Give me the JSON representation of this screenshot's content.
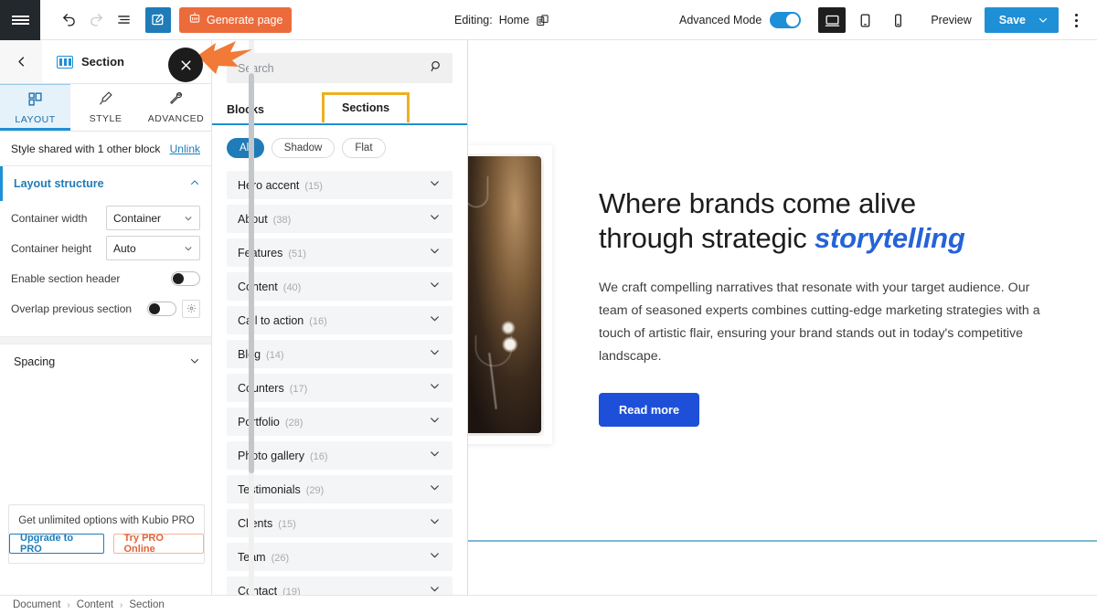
{
  "topbar": {
    "menu_icon": "hamburger-icon",
    "undo_icon": "undo-icon",
    "redo_icon": "redo-icon",
    "list_view_icon": "list-view-icon",
    "edit_icon": "edit-page-icon",
    "generate_label": "Generate page",
    "generate_icon": "ai-icon",
    "editing_label": "Editing:",
    "editing_page": "Home",
    "page_switch_icon": "page-switch-icon",
    "advanced_mode_label": "Advanced Mode",
    "advanced_mode_on": true,
    "desktop_icon": "desktop-icon",
    "tablet_icon": "tablet-icon",
    "mobile_icon": "mobile-icon",
    "preview_label": "Preview",
    "save_label": "Save",
    "save_caret_icon": "chevron-down-icon",
    "more_icon": "kebab-menu-icon"
  },
  "inspector": {
    "back_icon": "chevron-left-icon",
    "block_icon": "section-block-icon",
    "title": "Section",
    "close_icon": "close-icon",
    "tabs": [
      {
        "label": "LAYOUT",
        "icon": "layout-icon",
        "active": true
      },
      {
        "label": "STYLE",
        "icon": "brush-icon",
        "active": false
      },
      {
        "label": "ADVANCED",
        "icon": "wrench-icon",
        "active": false
      }
    ],
    "shared_text": "Style shared with 1 other block",
    "unlink_label": "Unlink",
    "layout_structure": {
      "title": "Layout structure",
      "expanded": true,
      "collapse_icon": "chevron-up-icon",
      "fields": [
        {
          "label": "Container width",
          "type": "select",
          "value": "Container"
        },
        {
          "label": "Container height",
          "type": "select",
          "value": "Auto"
        },
        {
          "label": "Enable section header",
          "type": "toggle",
          "value": false
        },
        {
          "label": "Overlap previous section",
          "type": "toggle",
          "value": false,
          "has_gear": true
        }
      ]
    },
    "spacing": {
      "title": "Spacing",
      "expanded": false,
      "expand_icon": "chevron-down-icon"
    },
    "pro": {
      "text": "Get unlimited options with Kubio PRO",
      "upgrade_label": "Upgrade to PRO",
      "try_label": "Try PRO Online"
    }
  },
  "breadcrumb": {
    "items": [
      "Document",
      "Content",
      "Section"
    ],
    "separator": "›"
  },
  "library": {
    "search_placeholder": "Search",
    "search_value": "",
    "search_icon": "search-icon",
    "tabs": [
      {
        "label": "Blocks",
        "active": false
      },
      {
        "label": "Sections",
        "active": true
      }
    ],
    "filters": [
      {
        "label": "All",
        "active": true
      },
      {
        "label": "Shadow",
        "active": false
      },
      {
        "label": "Flat",
        "active": false
      }
    ],
    "categories": [
      {
        "name": "Hero accent",
        "count": "(15)"
      },
      {
        "name": "About",
        "count": "(38)"
      },
      {
        "name": "Features",
        "count": "(51)"
      },
      {
        "name": "Content",
        "count": "(40)"
      },
      {
        "name": "Call to action",
        "count": "(16)"
      },
      {
        "name": "Blog",
        "count": "(14)"
      },
      {
        "name": "Counters",
        "count": "(17)"
      },
      {
        "name": "Portfolio",
        "count": "(28)"
      },
      {
        "name": "Photo gallery",
        "count": "(16)"
      },
      {
        "name": "Testimonials",
        "count": "(29)"
      },
      {
        "name": "Clients",
        "count": "(15)"
      },
      {
        "name": "Team",
        "count": "(26)"
      },
      {
        "name": "Contact",
        "count": "(19)"
      }
    ],
    "expand_icon": "chevron-down-icon"
  },
  "canvas": {
    "hero": {
      "image_alt": "dark-cocktail-photo",
      "heading_line1": "Where brands come alive",
      "heading_line2_plain": "through strategic ",
      "heading_line2_accent": "storytelling",
      "paragraph": "We craft compelling narratives that resonate with your target audience. Our team of seasoned experts combines cutting-edge marketing strategies with a touch of artistic flair, ensuring your brand stands out in today's competitive landscape.",
      "cta_label": "Read more"
    }
  },
  "colors": {
    "accent_blue": "#1f8fd6",
    "link_blue": "#1f7cb9",
    "cta_blue": "#1d4fd8",
    "orange": "#ec6b3b",
    "highlight_yellow": "#edb01f",
    "dark": "#23282d"
  }
}
